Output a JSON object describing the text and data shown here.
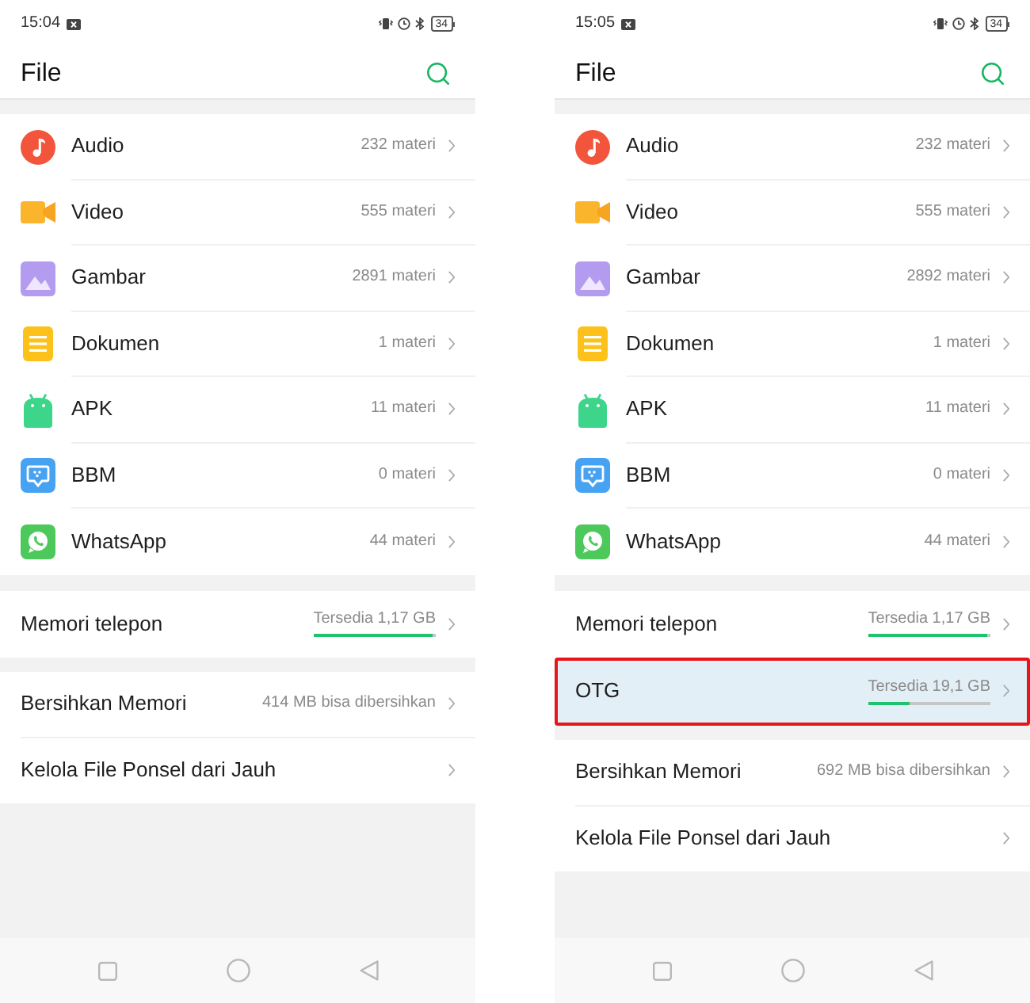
{
  "screens": [
    {
      "status_bar": {
        "time": "15:04",
        "battery": "34"
      },
      "header": {
        "title": "File"
      },
      "categories": [
        {
          "kind": "audio",
          "label": "Audio",
          "count": "232 materi"
        },
        {
          "kind": "video",
          "label": "Video",
          "count": "555 materi"
        },
        {
          "kind": "image",
          "label": "Gambar",
          "count": "2891 materi"
        },
        {
          "kind": "document",
          "label": "Dokumen",
          "count": "1 materi"
        },
        {
          "kind": "apk",
          "label": "APK",
          "count": "11 materi"
        },
        {
          "kind": "bbm",
          "label": "BBM",
          "count": "0 materi"
        },
        {
          "kind": "whatsapp",
          "label": "WhatsApp",
          "count": "44 materi"
        }
      ],
      "storage": [
        {
          "label": "Memori telepon",
          "reading": "Tersedia 1,17 GB",
          "level": 0.97,
          "highlighted": false
        }
      ],
      "tools": [
        {
          "label": "Bersihkan Memori",
          "detail": "414 MB bisa dibersihkan"
        },
        {
          "label": "Kelola File Ponsel dari Jauh"
        }
      ]
    },
    {
      "status_bar": {
        "time": "15:05",
        "battery": "34"
      },
      "header": {
        "title": "File"
      },
      "categories": [
        {
          "kind": "audio",
          "label": "Audio",
          "count": "232 materi"
        },
        {
          "kind": "video",
          "label": "Video",
          "count": "555 materi"
        },
        {
          "kind": "image",
          "label": "Gambar",
          "count": "2892 materi"
        },
        {
          "kind": "document",
          "label": "Dokumen",
          "count": "1 materi"
        },
        {
          "kind": "apk",
          "label": "APK",
          "count": "11 materi"
        },
        {
          "kind": "bbm",
          "label": "BBM",
          "count": "0 materi"
        },
        {
          "kind": "whatsapp",
          "label": "WhatsApp",
          "count": "44 materi"
        }
      ],
      "storage": [
        {
          "label": "Memori telepon",
          "reading": "Tersedia 1,17 GB",
          "level": 0.97,
          "highlighted": false
        },
        {
          "label": "OTG",
          "reading": "Tersedia 19,1 GB",
          "level": 0.34,
          "highlighted": true
        }
      ],
      "tools": [
        {
          "label": "Bersihkan Memori",
          "detail": "692 MB bisa dibersihkan"
        },
        {
          "label": "Kelola File Ponsel dari Jauh"
        }
      ]
    }
  ]
}
